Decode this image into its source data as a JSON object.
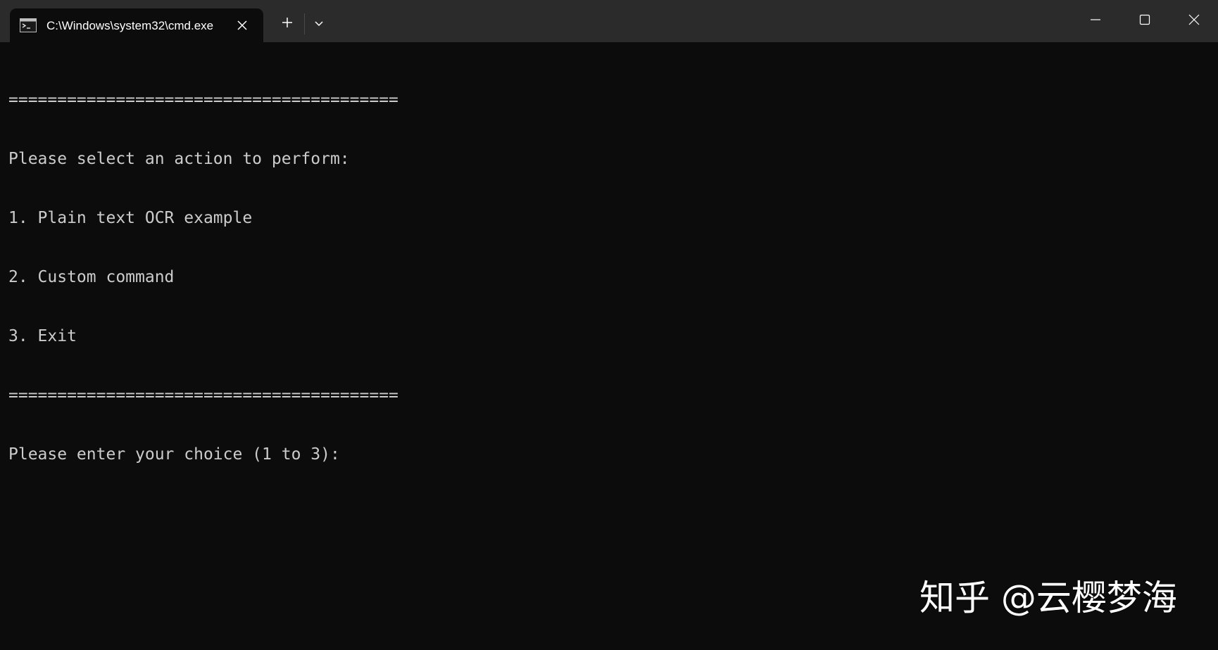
{
  "window": {
    "tab_title": "C:\\Windows\\system32\\cmd.exe",
    "tab_icon": "terminal-icon",
    "new_tab_icon": "plus-icon",
    "dropdown_icon": "chevron-down-icon",
    "controls": [
      "minimize-icon",
      "maximize-icon",
      "close-icon"
    ]
  },
  "console": {
    "lines": [
      "========================================",
      "Please select an action to perform:",
      "1. Plain text OCR example",
      "2. Custom command",
      "3. Exit",
      "========================================",
      "Please enter your choice (1 to 3):"
    ]
  },
  "watermark": {
    "text": "知乎 @云樱梦海"
  },
  "colors": {
    "background": "#0c0c0c",
    "titlebar": "#2b2b2b",
    "text": "#cccccc",
    "tab_text": "#ffffff"
  }
}
